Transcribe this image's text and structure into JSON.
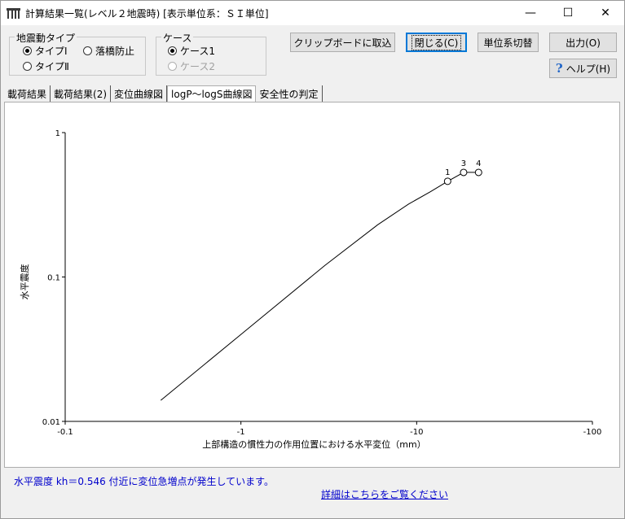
{
  "window": {
    "title": "計算結果一覧(レベル２地震時) [表示単位系：ＳＩ単位]",
    "min_symbol": "—",
    "max_symbol": "☐",
    "close_symbol": "✕"
  },
  "seismic_type_group": {
    "label": "地震動タイプ",
    "options": [
      {
        "label": "タイプⅠ",
        "selected": true
      },
      {
        "label": "落橋防止",
        "selected": false
      },
      {
        "label": "タイプⅡ",
        "selected": false
      }
    ]
  },
  "case_group": {
    "label": "ケース",
    "options": [
      {
        "label": "ケース1",
        "selected": true,
        "enabled": true
      },
      {
        "label": "ケース2",
        "selected": false,
        "enabled": false
      }
    ]
  },
  "buttons": {
    "clipboard": "クリップボードに取込",
    "close": "閉じる(C)",
    "unit_switch": "単位系切替",
    "output": "出力(O)",
    "help": "ヘルプ(H)"
  },
  "tabs": [
    "載荷結果",
    "載荷結果(2)",
    "変位曲線図",
    "logP～logS曲線図",
    "安全性の判定"
  ],
  "active_tab": 3,
  "chart_data": {
    "type": "line",
    "x_scale": "log",
    "y_scale": "log",
    "xlabel": "上部構造の慣性力の作用位置における水平変位（mm）",
    "ylabel": "水平震度",
    "x_ticks": [
      "-0.1",
      "-1",
      "-10",
      "-100"
    ],
    "y_ticks": [
      "1",
      "0.1",
      "0.01"
    ],
    "xlim": [
      0.1,
      100
    ],
    "ylim": [
      0.01,
      1
    ],
    "series": [
      {
        "x": [
          0.35,
          1.0,
          3.0,
          6.0,
          9.0,
          12.0,
          15.0,
          18.5,
          22.5
        ],
        "y": [
          0.014,
          0.04,
          0.12,
          0.23,
          0.32,
          0.39,
          0.46,
          0.53,
          0.53
        ]
      }
    ],
    "markers": [
      {
        "label": "1",
        "x": 15.0,
        "y": 0.46
      },
      {
        "label": "3",
        "x": 18.5,
        "y": 0.53
      },
      {
        "label": "4",
        "x": 22.5,
        "y": 0.53
      }
    ]
  },
  "status": {
    "message": "水平震度 kh＝0.546 付近に変位急増点が発生しています。",
    "detail_link": "詳細はこちらをご覧ください"
  }
}
